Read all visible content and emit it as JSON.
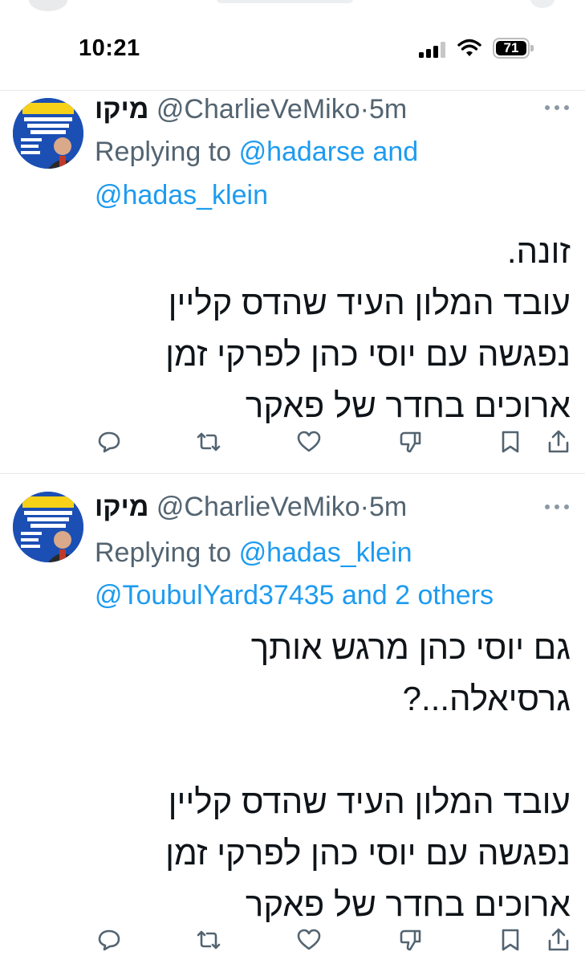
{
  "status_bar": {
    "time": "10:21",
    "battery_level": "71"
  },
  "tweets": [
    {
      "display_name": "מיקו",
      "handle": "@CharlieVeMiko",
      "separator": "·",
      "timestamp": "5m",
      "replying_label": "Replying to",
      "reply_line_1_mention": "@hadarse",
      "reply_line_1_suffix": "and",
      "reply_line_2": "@hadas_klein",
      "text": "זונה.\nעובד המלון העיד שהדס קליין\nנפגשה עם יוסי כהן לפרקי זמן\nארוכים בחדר של פאקר"
    },
    {
      "display_name": "מיקו",
      "handle": "@CharlieVeMiko",
      "separator": "·",
      "timestamp": "5m",
      "replying_label": "Replying to",
      "reply_line_1_mention": "@hadas_klein",
      "reply_line_2": "@ToubulYard37435 and 2 others",
      "text": "גם יוסי כהן מרגש אותך\nגרסיאלה...?\n\nעובד המלון העיד שהדס קליין\nנפגשה עם יוסי כהן לפרקי זמן\nארוכים בחדר של פאקר"
    }
  ],
  "icons": {
    "reply": "reply-icon",
    "retweet": "retweet-icon",
    "like": "heart-icon",
    "downvote": "downvote-icon",
    "bookmark": "bookmark-icon",
    "share": "share-icon",
    "more": "more-icon"
  },
  "colors": {
    "link": "#1d9bf0",
    "secondary": "#536471",
    "text": "#0f1419"
  }
}
